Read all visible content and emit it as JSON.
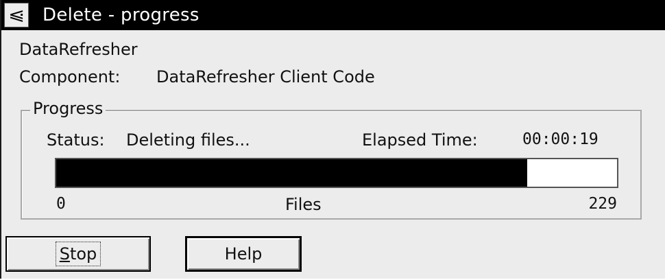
{
  "window": {
    "title": "Delete - progress",
    "system_menu_icon": "minimize-arrow-icon"
  },
  "product": "DataRefresher",
  "component": {
    "label": "Component:",
    "value": "DataRefresher Client Code"
  },
  "progress_group": {
    "title": "Progress",
    "status_label": "Status:",
    "status_value": "Deleting files...",
    "elapsed_label": "Elapsed Time:",
    "elapsed_value": "00:00:19",
    "fraction_complete": 0.84,
    "scale_min": "0",
    "scale_label": "Files",
    "scale_max": "229"
  },
  "buttons": {
    "stop_mnemonic": "S",
    "stop_rest": "top",
    "help_label": "Help"
  },
  "colors": {
    "titlebar": "#000000",
    "progress_fill": "#000000",
    "dialog_background": "#ececec"
  }
}
